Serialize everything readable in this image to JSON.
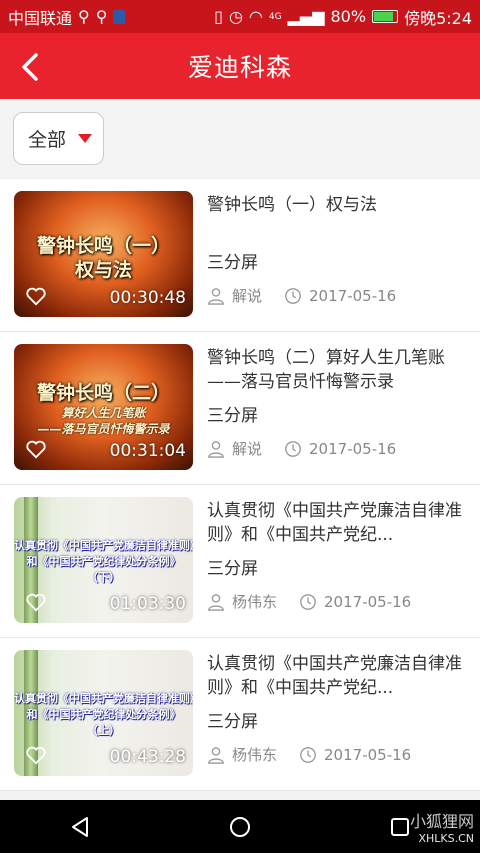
{
  "status": {
    "carrier": "中国联通",
    "signal_labels": [
      "4G"
    ],
    "battery": "80%",
    "time": "傍晚5:24"
  },
  "header": {
    "title": "爱迪科森"
  },
  "filter": {
    "selected": "全部"
  },
  "items": [
    {
      "thumb_title": "警钟长鸣（一）",
      "thumb_sub": "权与法",
      "duration": "00:30:48",
      "title": "警钟长鸣（一）权与法",
      "format": "三分屏",
      "speaker": "解说",
      "date": "2017-05-16"
    },
    {
      "thumb_title": "警钟长鸣（二）",
      "thumb_sub": "算好人生几笔账",
      "thumb_sub2": "——落马官员忏悔警示录",
      "duration": "00:31:04",
      "title": "警钟长鸣（二）算好人生几笔账——落马官员忏悔警示录",
      "format": "三分屏",
      "speaker": "解说",
      "date": "2017-05-16"
    },
    {
      "thumb_line1": "认真贯彻《中国共产党廉洁自律准则》",
      "thumb_line2": "和《中国共产党纪律处分条例》",
      "thumb_line3": "（下）",
      "duration": "01:03:30",
      "title": "认真贯彻《中国共产党廉洁自律准则》和《中国共产党纪...",
      "format": "三分屏",
      "speaker": "杨伟东",
      "date": "2017-05-16"
    },
    {
      "thumb_line1": "认真贯彻《中国共产党廉洁自律准则》",
      "thumb_line2": "和《中国共产党纪律处分条例》",
      "thumb_line3": "（上）",
      "duration": "00:43:28",
      "title": "认真贯彻《中国共产党廉洁自律准则》和《中国共产党纪...",
      "format": "三分屏",
      "speaker": "杨伟东",
      "date": "2017-05-16"
    }
  ],
  "watermark": {
    "cn": "小狐狸网",
    "en": "XHLKS.CN"
  },
  "colors": {
    "brand_red": "#e8232d",
    "status_red": "#c8141b"
  }
}
